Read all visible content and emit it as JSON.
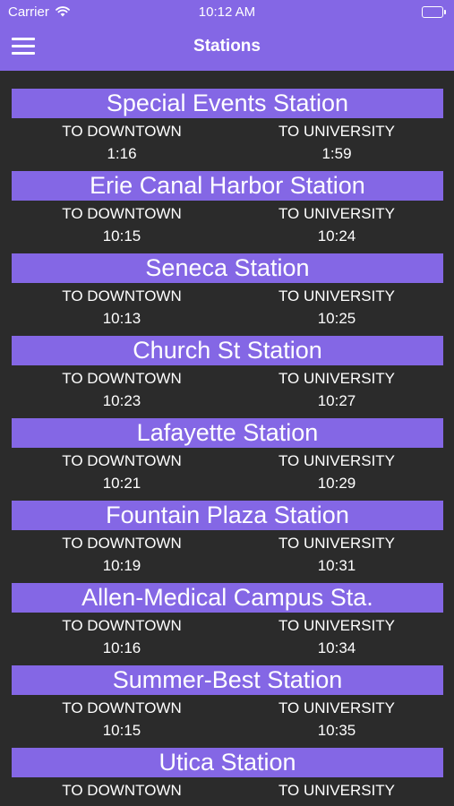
{
  "status_bar": {
    "carrier": "Carrier",
    "time": "10:12 AM",
    "wifi_icon": "wifi-icon",
    "battery_icon": "battery-icon"
  },
  "nav": {
    "title": "Stations",
    "menu_icon": "hamburger-menu-icon"
  },
  "colors": {
    "accent": "#8467e5",
    "background": "#2b2b2b",
    "text": "#ffffff"
  },
  "stations": [
    {
      "name": "Special Events Station",
      "to_downtown_label": "TO DOWNTOWN",
      "to_downtown_time": "1:16",
      "to_university_label": "TO UNIVERSITY",
      "to_university_time": "1:59"
    },
    {
      "name": "Erie Canal Harbor Station",
      "to_downtown_label": "TO DOWNTOWN",
      "to_downtown_time": "10:15",
      "to_university_label": "TO UNIVERSITY",
      "to_university_time": "10:24"
    },
    {
      "name": "Seneca Station",
      "to_downtown_label": "TO DOWNTOWN",
      "to_downtown_time": "10:13",
      "to_university_label": "TO UNIVERSITY",
      "to_university_time": "10:25"
    },
    {
      "name": "Church St Station",
      "to_downtown_label": "TO DOWNTOWN",
      "to_downtown_time": "10:23",
      "to_university_label": "TO UNIVERSITY",
      "to_university_time": "10:27"
    },
    {
      "name": "Lafayette Station",
      "to_downtown_label": "TO DOWNTOWN",
      "to_downtown_time": "10:21",
      "to_university_label": "TO UNIVERSITY",
      "to_university_time": "10:29"
    },
    {
      "name": "Fountain Plaza Station",
      "to_downtown_label": "TO DOWNTOWN",
      "to_downtown_time": "10:19",
      "to_university_label": "TO UNIVERSITY",
      "to_university_time": "10:31"
    },
    {
      "name": "Allen-Medical Campus Sta.",
      "to_downtown_label": "TO DOWNTOWN",
      "to_downtown_time": "10:16",
      "to_university_label": "TO UNIVERSITY",
      "to_university_time": "10:34"
    },
    {
      "name": "Summer-Best Station",
      "to_downtown_label": "TO DOWNTOWN",
      "to_downtown_time": "10:15",
      "to_university_label": "TO UNIVERSITY",
      "to_university_time": "10:35"
    },
    {
      "name": "Utica Station",
      "to_downtown_label": "TO DOWNTOWN",
      "to_downtown_time": "",
      "to_university_label": "TO UNIVERSITY",
      "to_university_time": ""
    }
  ]
}
